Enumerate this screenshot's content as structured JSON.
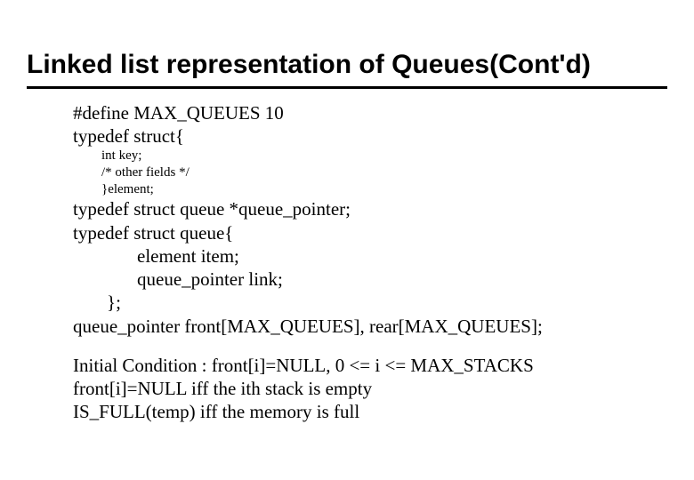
{
  "title": "Linked list representation of Queues(Cont'd)",
  "code": {
    "l1": "#define MAX_QUEUES  10",
    "l2": "typedef struct{",
    "l3": "int key;",
    "l4": "/* other fields */",
    "l5": "}element;",
    "l6": "typedef struct queue *queue_pointer;",
    "l7": "typedef struct queue{",
    "l8": "element  item;",
    "l9": "queue_pointer link;",
    "l10": "};",
    "l11": "queue_pointer front[MAX_QUEUES], rear[MAX_QUEUES];",
    "l12": "Initial Condition : front[i]=NULL, 0 <= i <= MAX_STACKS",
    "l13": "front[i]=NULL iff the ith stack is empty",
    "l14": "IS_FULL(temp) iff the memory is full"
  }
}
